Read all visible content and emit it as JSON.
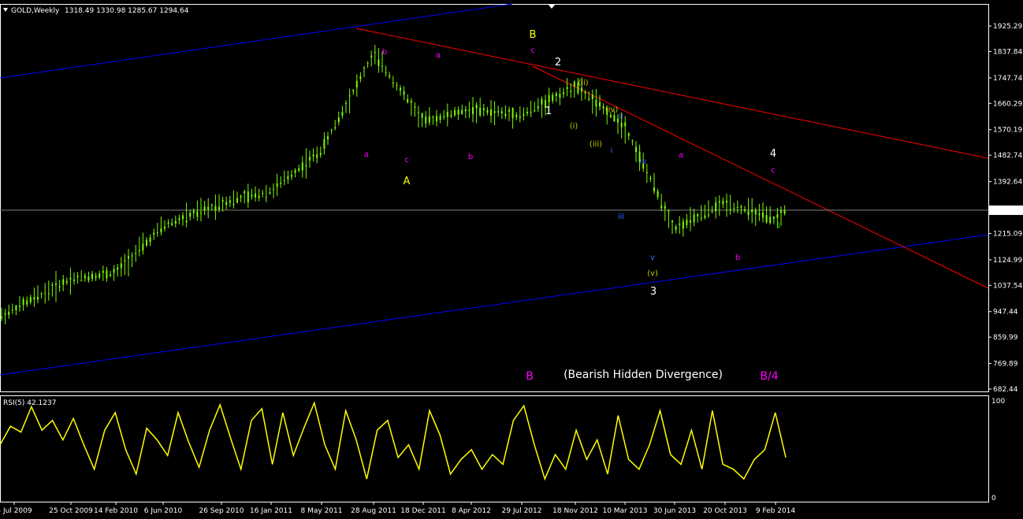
{
  "header": {
    "symbol": "GOLD,Weekly",
    "ohlc": "1318.49 1330.98 1285.67 1294.64"
  },
  "rsi_header": "RSI(5) 42.1237",
  "price_axis": {
    "ticks": [
      "1925.29",
      "1837.84",
      "1747.74",
      "1660.29",
      "1570.19",
      "1482.74",
      "1392.64",
      "1294.64",
      "1215.09",
      "1124.99",
      "1037.54",
      "947.44",
      "859.99",
      "769.89",
      "682.44"
    ],
    "current": "1294.64"
  },
  "rsi_axis": {
    "ticks": [
      "100",
      "0"
    ]
  },
  "date_axis": {
    "ticks": [
      "5 Jul 2009",
      "25 Oct 2009",
      "14 Feb 2010",
      "6 Jun 2010",
      "26 Sep 2010",
      "16 Jan 2011",
      "8 May 2011",
      "28 Aug 2011",
      "18 Dec 2011",
      "8 Apr 2012",
      "29 Jul 2012",
      "18 Nov 2012",
      "10 Mar 2013",
      "30 Jun 2013",
      "20 Oct 2013",
      "9 Feb 2014"
    ]
  },
  "annotations": [
    {
      "text": "B",
      "color": "#ffff00"
    },
    {
      "text": "c",
      "color": "#ff00ff"
    },
    {
      "text": "2",
      "color": "#ffffff"
    },
    {
      "text": "(ii)",
      "color": "#c8c800"
    },
    {
      "text": "1",
      "color": "#ffffff"
    },
    {
      "text": "(iv)",
      "color": "#c8c800"
    },
    {
      "text": "ii",
      "color": "#3c64ff"
    },
    {
      "text": "(i)",
      "color": "#c8c800"
    },
    {
      "text": "(iii)",
      "color": "#c8c800"
    },
    {
      "text": "i",
      "color": "#3c64ff"
    },
    {
      "text": "iv",
      "color": "#3c64ff"
    },
    {
      "text": "iii",
      "color": "#3c64ff"
    },
    {
      "text": "v",
      "color": "#3c64ff"
    },
    {
      "text": "(v)",
      "color": "#c8c800"
    },
    {
      "text": "3",
      "color": "#ffffff"
    },
    {
      "text": "b",
      "color": "#ff00ff"
    },
    {
      "text": "a",
      "color": "#ff00ff"
    },
    {
      "text": "a",
      "color": "#ff00ff"
    },
    {
      "text": "c",
      "color": "#ff00ff"
    },
    {
      "text": "b",
      "color": "#ff00ff"
    },
    {
      "text": "A",
      "color": "#ffff00"
    },
    {
      "text": "a",
      "color": "#ff00ff"
    },
    {
      "text": "b",
      "color": "#ff00ff"
    },
    {
      "text": "4",
      "color": "#ffffff"
    },
    {
      "text": "c",
      "color": "#ff00ff"
    },
    {
      "text": "1",
      "color": "#00c800"
    },
    {
      "text": "B",
      "color": "#ff00ff"
    },
    {
      "text": "(Bearish Hidden Divergence)",
      "color": "#ffffff"
    },
    {
      "text": "B/4",
      "color": "#ff00ff"
    }
  ],
  "colors": {
    "background": "#000000",
    "candle": "#7cfc00",
    "rsi": "#ffff00",
    "channel": "#0000ff",
    "trendline": "#ff0000",
    "frame": "#ffffff"
  },
  "chart_data": {
    "type": "candlestick",
    "symbol": "GOLD",
    "timeframe": "Weekly",
    "last": {
      "open": 1318.49,
      "high": 1330.98,
      "low": 1285.67,
      "close": 1294.64
    },
    "ylim": [
      682.44,
      1925.29
    ],
    "price_anchors": [
      [
        "5 Jul 2009",
        930
      ],
      [
        "25 Oct 2009",
        1060
      ],
      [
        "14 Feb 2010",
        1080
      ],
      [
        "6 Jun 2010",
        1240
      ],
      [
        "26 Sep 2010",
        1320
      ],
      [
        "16 Jan 2011",
        1360
      ],
      [
        "8 May 2011",
        1500
      ],
      [
        "28 Aug 2011",
        1830
      ],
      [
        "18 Dec 2011",
        1600
      ],
      [
        "8 Apr 2012",
        1640
      ],
      [
        "29 Jul 2012",
        1620
      ],
      [
        "18 Nov 2012",
        1720
      ],
      [
        "10 Mar 2013",
        1580
      ],
      [
        "30 Jun 2013",
        1230
      ],
      [
        "20 Oct 2013",
        1320
      ],
      [
        "9 Feb 2014",
        1260
      ],
      [
        "Mar 2014",
        1294.64
      ]
    ],
    "rsi": {
      "name": "RSI(5)",
      "last": 42.1237,
      "ylim": [
        0,
        100
      ],
      "values": [
        55,
        74,
        68,
        94,
        70,
        80,
        60,
        82,
        55,
        30,
        70,
        88,
        50,
        25,
        72,
        60,
        44,
        88,
        58,
        32,
        70,
        96,
        62,
        30,
        80,
        92,
        35,
        88,
        44,
        72,
        98,
        55,
        30,
        90,
        60,
        20,
        70,
        80,
        42,
        55,
        30,
        90,
        65,
        25,
        40,
        50,
        30,
        45,
        35,
        80,
        95,
        55,
        20,
        45,
        30,
        70,
        40,
        60,
        25,
        85,
        40,
        30,
        55,
        90,
        45,
        35,
        70,
        30,
        90,
        35,
        30,
        20,
        40,
        50,
        88,
        42
      ]
    }
  }
}
